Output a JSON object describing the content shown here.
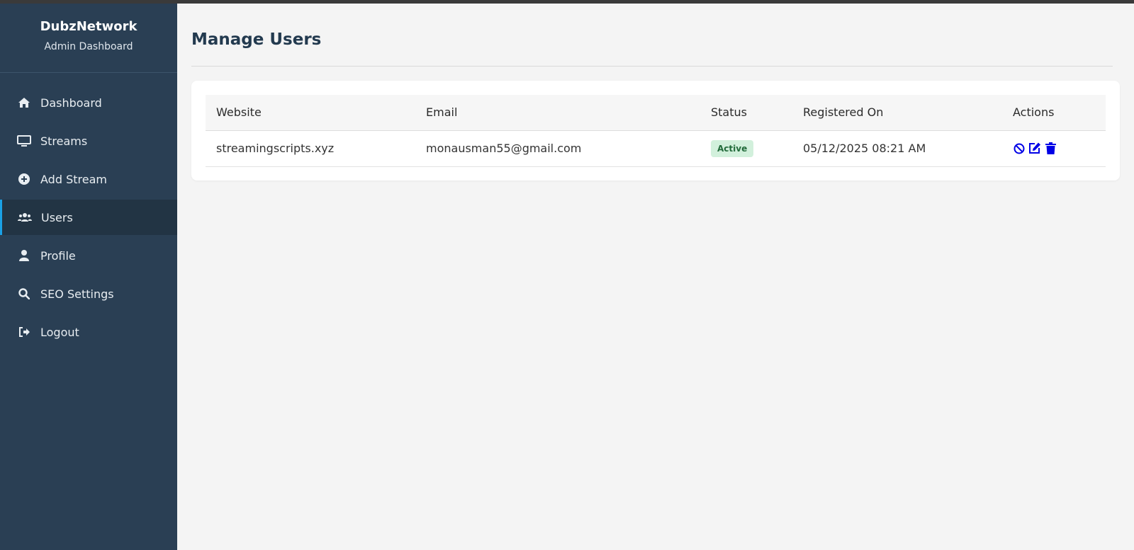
{
  "brand": {
    "name": "DubzNetwork",
    "subtitle": "Admin Dashboard"
  },
  "sidebar": {
    "items": [
      {
        "label": "Dashboard",
        "icon": "home-icon",
        "active": false
      },
      {
        "label": "Streams",
        "icon": "monitor-icon",
        "active": false
      },
      {
        "label": "Add Stream",
        "icon": "plus-circle-icon",
        "active": false
      },
      {
        "label": "Users",
        "icon": "users-icon",
        "active": true
      },
      {
        "label": "Profile",
        "icon": "user-icon",
        "active": false
      },
      {
        "label": "SEO Settings",
        "icon": "search-icon",
        "active": false
      },
      {
        "label": "Logout",
        "icon": "logout-icon",
        "active": false
      }
    ]
  },
  "main": {
    "title": "Manage Users",
    "table": {
      "headers": [
        "Website",
        "Email",
        "Status",
        "Registered On",
        "Actions"
      ],
      "rows": [
        {
          "website": "streamingscripts.xyz",
          "email": "monausman55@gmail.com",
          "status": "Active",
          "registered_on": "05/12/2025 08:21 AM",
          "actions": [
            "ban-icon",
            "edit-icon",
            "trash-icon"
          ]
        }
      ]
    }
  },
  "colors": {
    "sidebar_bg": "#2a3f54",
    "active_accent": "#1aa1e6",
    "action_icon": "#0000e6",
    "badge_bg": "#d2f0dc",
    "badge_text": "#236b3b"
  }
}
